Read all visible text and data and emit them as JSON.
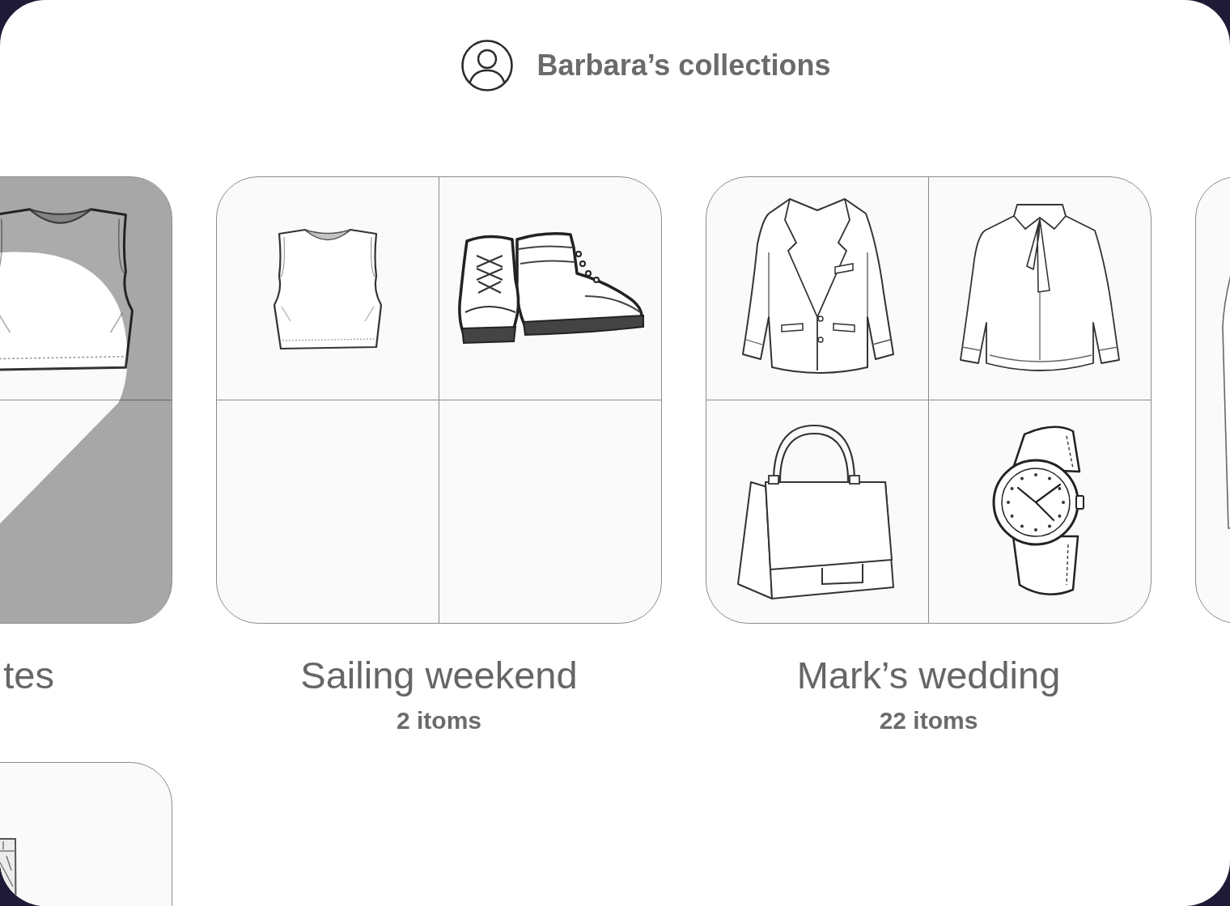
{
  "header": {
    "title": "Barbara’s collections"
  },
  "collection_rows": [
    [
      {
        "kind": "grid",
        "selected": true,
        "title": "tes",
        "title_cut": true,
        "cells": [
          {
            "kind": "empty"
          },
          {
            "kind": "top"
          },
          {
            "kind": "empty"
          },
          {
            "kind": "empty"
          }
        ]
      },
      {
        "kind": "grid",
        "selected": false,
        "title": "Sailing weekend",
        "title_cut": false,
        "count": "2 itoms",
        "cells": [
          {
            "kind": "top"
          },
          {
            "kind": "boots"
          },
          {
            "kind": "empty"
          },
          {
            "kind": "empty"
          }
        ]
      },
      {
        "kind": "grid",
        "selected": false,
        "title": "Mark’s wedding",
        "title_cut": false,
        "count": "22 itoms",
        "cells": [
          {
            "kind": "blazer"
          },
          {
            "kind": "shirt"
          },
          {
            "kind": "bag"
          },
          {
            "kind": "watch"
          }
        ]
      },
      {
        "kind": "single",
        "selected": false,
        "item": {
          "kind": "dress"
        }
      }
    ],
    [
      {
        "kind": "single",
        "selected": false,
        "item": {
          "kind": "trousers"
        }
      }
    ]
  ]
}
